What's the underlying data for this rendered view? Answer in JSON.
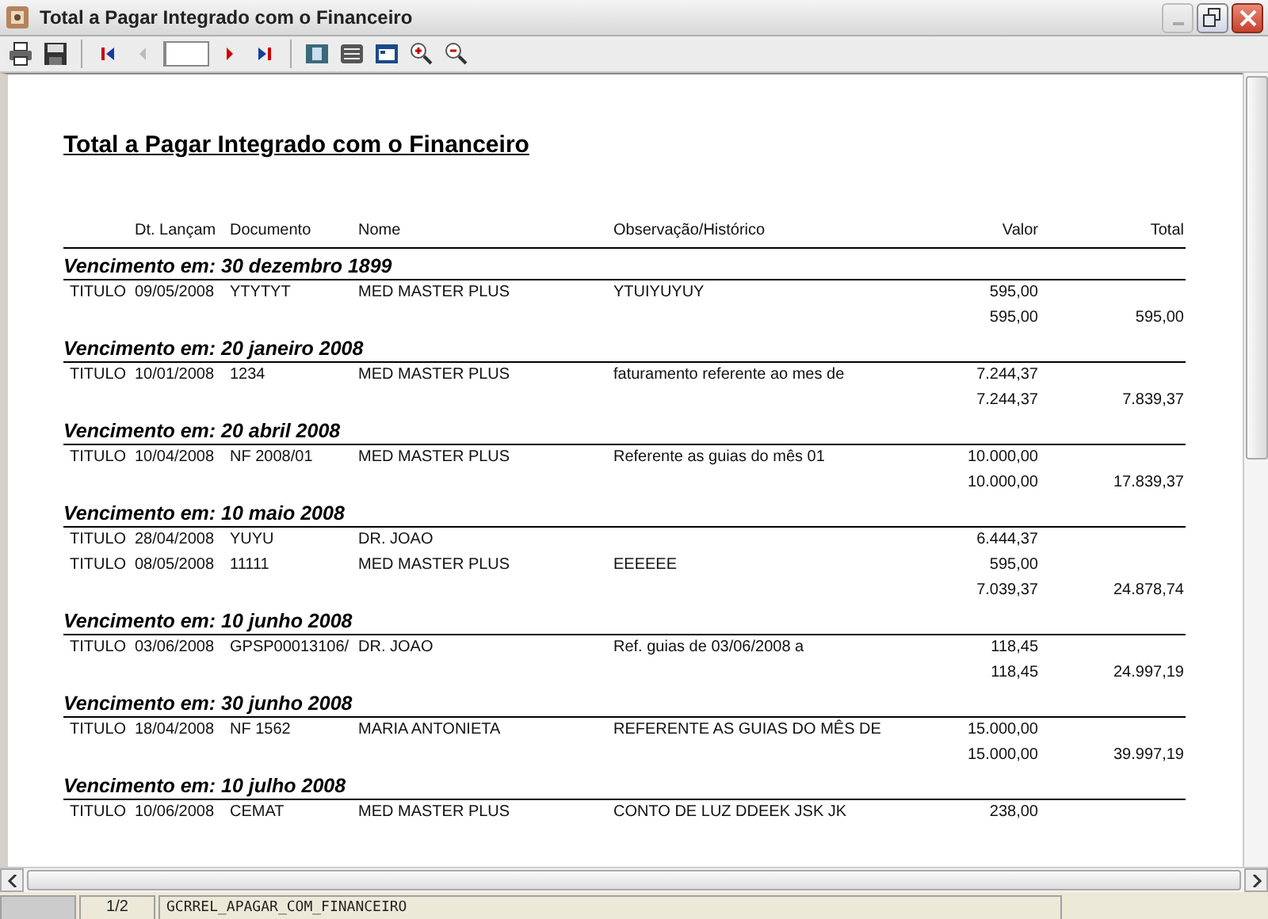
{
  "window": {
    "title": "Total a Pagar Integrado com o Financeiro"
  },
  "toolbar": {
    "prev_disabled": true
  },
  "report": {
    "title": "Total a Pagar Integrado com o Financeiro",
    "columns": [
      "Dt. Lançam",
      "Documento",
      "Nome",
      "Observação/Histórico",
      "Valor",
      "Total"
    ],
    "groups": [
      {
        "heading": "Vencimento em: 30 dezembro 1899",
        "rows": [
          {
            "type": "TITULO",
            "date": "09/05/2008",
            "document": "YTYTYT",
            "name": "MED MASTER PLUS",
            "note": "YTUIYUYUY",
            "value": "595,00"
          }
        ],
        "subtotal": "595,00",
        "total": "595,00"
      },
      {
        "heading": "Vencimento em: 20 janeiro 2008",
        "rows": [
          {
            "type": "TITULO",
            "date": "10/01/2008",
            "document": "1234",
            "name": "MED MASTER PLUS",
            "note": "faturamento referente ao mes de",
            "value": "7.244,37"
          }
        ],
        "subtotal": "7.244,37",
        "total": "7.839,37"
      },
      {
        "heading": "Vencimento em: 20 abril 2008",
        "rows": [
          {
            "type": "TITULO",
            "date": "10/04/2008",
            "document": "NF 2008/01",
            "name": "MED MASTER PLUS",
            "note": "Referente as guias do mês 01",
            "value": "10.000,00"
          }
        ],
        "subtotal": "10.000,00",
        "total": "17.839,37"
      },
      {
        "heading": "Vencimento em: 10 maio 2008",
        "rows": [
          {
            "type": "TITULO",
            "date": "28/04/2008",
            "document": "YUYU",
            "name": "DR. JOAO",
            "value": "6.444,37"
          },
          {
            "type": "TITULO",
            "date": "08/05/2008",
            "document": "11111",
            "name": "MED MASTER PLUS",
            "note": "EEEEEE",
            "value": "595,00"
          }
        ],
        "subtotal": "7.039,37",
        "total": "24.878,74"
      },
      {
        "heading": "Vencimento em: 10 junho 2008",
        "rows": [
          {
            "type": "TITULO",
            "date": "03/06/2008",
            "document": "GPSP00013106/",
            "name": "DR. JOAO",
            "note": "Ref. guias de 03/06/2008 a",
            "value": "118,45"
          }
        ],
        "subtotal": "118,45",
        "total": "24.997,19"
      },
      {
        "heading": "Vencimento em: 30 junho 2008",
        "rows": [
          {
            "type": "TITULO",
            "date": "18/04/2008",
            "document": "NF 1562",
            "name": "MARIA ANTONIETA",
            "note": "REFERENTE AS GUIAS DO MÊS DE",
            "value": "15.000,00"
          }
        ],
        "subtotal": "15.000,00",
        "total": "39.997,19"
      },
      {
        "heading": "Vencimento em: 10 julho 2008",
        "rows": [
          {
            "type": "TITULO",
            "date": "10/06/2008",
            "document": "CEMAT",
            "name": "MED MASTER PLUS",
            "note": "CONTO DE LUZ DDEEK JSK JK",
            "value": "238,00"
          }
        ]
      }
    ]
  },
  "status_bar": {
    "page": "1/2",
    "report_name": "GCRREL_APAGAR_COM_FINANCEIRO"
  }
}
